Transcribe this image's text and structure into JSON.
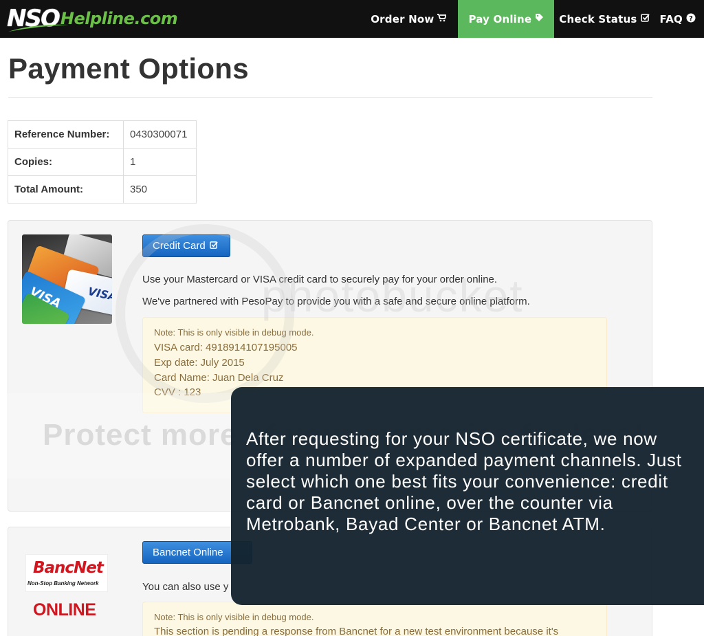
{
  "brand": {
    "logo_nso": "NSO",
    "logo_rest": "Helpline.com"
  },
  "nav": {
    "items": [
      {
        "label": "Order Now",
        "icon": "shopping-cart-icon",
        "active": false
      },
      {
        "label": "Pay Online",
        "icon": "tag-icon",
        "active": true
      },
      {
        "label": "Check Status",
        "icon": "check-square-icon",
        "active": false
      },
      {
        "label": "FAQ",
        "icon": "question-circle-icon",
        "active": false
      }
    ]
  },
  "page": {
    "title": "Payment Options"
  },
  "summary": {
    "rows": [
      {
        "label": "Reference Number:",
        "value": "0430300071"
      },
      {
        "label": "Copies:",
        "value": "1"
      },
      {
        "label": "Total Amount:",
        "value": "350"
      }
    ]
  },
  "credit_card": {
    "button_label": "Credit Card",
    "button_icon": "check-square-icon",
    "text1": "Use your Mastercard or VISA credit card to securely pay for your order online.",
    "text2": "We've partnered with PesoPay to provide you with a safe and secure online platform.",
    "debug": {
      "note": "Note: This is only visible in debug mode.",
      "lines": [
        "VISA card: 4918914107195005",
        "Exp date: July 2015",
        "Card Name: Juan Dela Cruz",
        "CVV : 123"
      ]
    }
  },
  "bancnet": {
    "logo_word": "BancNet",
    "logo_tagline": "Non-Stop Banking Network",
    "online_word": "ONLINE",
    "button_label": "Bancnet Online",
    "text1": "You can also use y",
    "debug": {
      "note": "Note: This is only visible in debug mode.",
      "lines": [
        "This section is pending a response from Bancnet for a new test environment because it's"
      ]
    }
  },
  "watermark": {
    "text": "Protect more of your memories for less!",
    "brand": "photobucket"
  },
  "overlay": {
    "text": "After requesting for your NSO certificate, we now offer a number of expanded payment channels. Just select which one best fits your convenience: credit card or Bancnet online, over the counter via Metrobank, Bayad Center or Bancnet ATM."
  },
  "colors": {
    "navbar": "#111111",
    "active_nav": "#5cb85c",
    "brand_green": "#6cc04a",
    "button_blue": "#1565c0",
    "bancnet_red": "#d0161f",
    "overlay_bg": "#14232e"
  }
}
